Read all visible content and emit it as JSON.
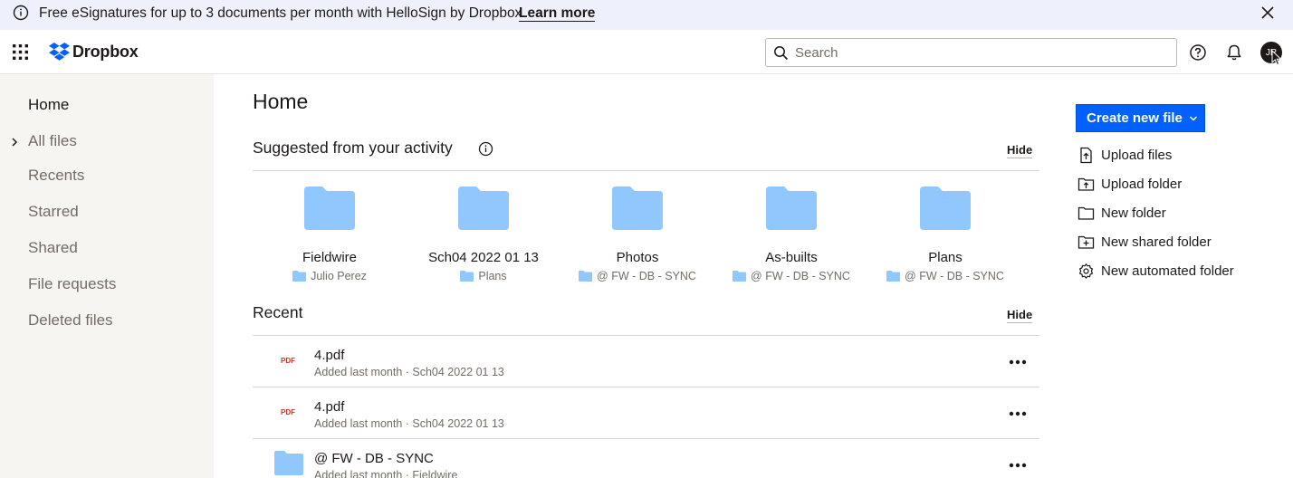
{
  "banner": {
    "message": "Free eSignatures for up to 3 documents per month with HelloSign by Dropbox.",
    "link": "Learn more"
  },
  "topbar": {
    "brand": "Dropbox",
    "search_placeholder": "Search",
    "avatar_initials": "JR"
  },
  "sidebar": {
    "items": [
      {
        "label": "Home",
        "active": true
      },
      {
        "label": "All files"
      },
      {
        "label": "Recents"
      },
      {
        "label": "Starred"
      },
      {
        "label": "Shared"
      },
      {
        "label": "File requests"
      },
      {
        "label": "Deleted files"
      }
    ]
  },
  "main": {
    "title": "Home",
    "suggested": {
      "title": "Suggested from your activity",
      "hide": "Hide",
      "items": [
        {
          "name": "Fieldwire",
          "location": "Julio Perez"
        },
        {
          "name": "Sch04 2022 01 13",
          "location": "Plans"
        },
        {
          "name": "Photos",
          "location": "@ FW - DB - SYNC"
        },
        {
          "name": "As-builts",
          "location": "@ FW - DB - SYNC"
        },
        {
          "name": "Plans",
          "location": "@ FW - DB - SYNC"
        }
      ]
    },
    "recent": {
      "title": "Recent",
      "hide": "Hide",
      "rows": [
        {
          "type": "pdf",
          "icon_label": "PDF",
          "name": "4.pdf",
          "meta": "Added last month · Sch04 2022 01 13"
        },
        {
          "type": "pdf",
          "icon_label": "PDF",
          "name": "4.pdf",
          "meta": "Added last month · Sch04 2022 01 13"
        },
        {
          "type": "folder",
          "name": "@ FW - DB - SYNC",
          "meta": "Added last month · Fieldwire"
        }
      ]
    }
  },
  "actions": {
    "create": "Create new file",
    "items": [
      {
        "label": "Upload files",
        "icon": "upload-file-icon"
      },
      {
        "label": "Upload folder",
        "icon": "upload-folder-icon"
      },
      {
        "label": "New folder",
        "icon": "folder-icon"
      },
      {
        "label": "New shared folder",
        "icon": "shared-folder-icon"
      },
      {
        "label": "New automated folder",
        "icon": "gear-icon"
      }
    ]
  },
  "colors": {
    "accent": "#0061fe",
    "folder": "#90c8fd",
    "sidebar_bg": "#f7f5f2",
    "banner_bg": "#eef1fb"
  }
}
